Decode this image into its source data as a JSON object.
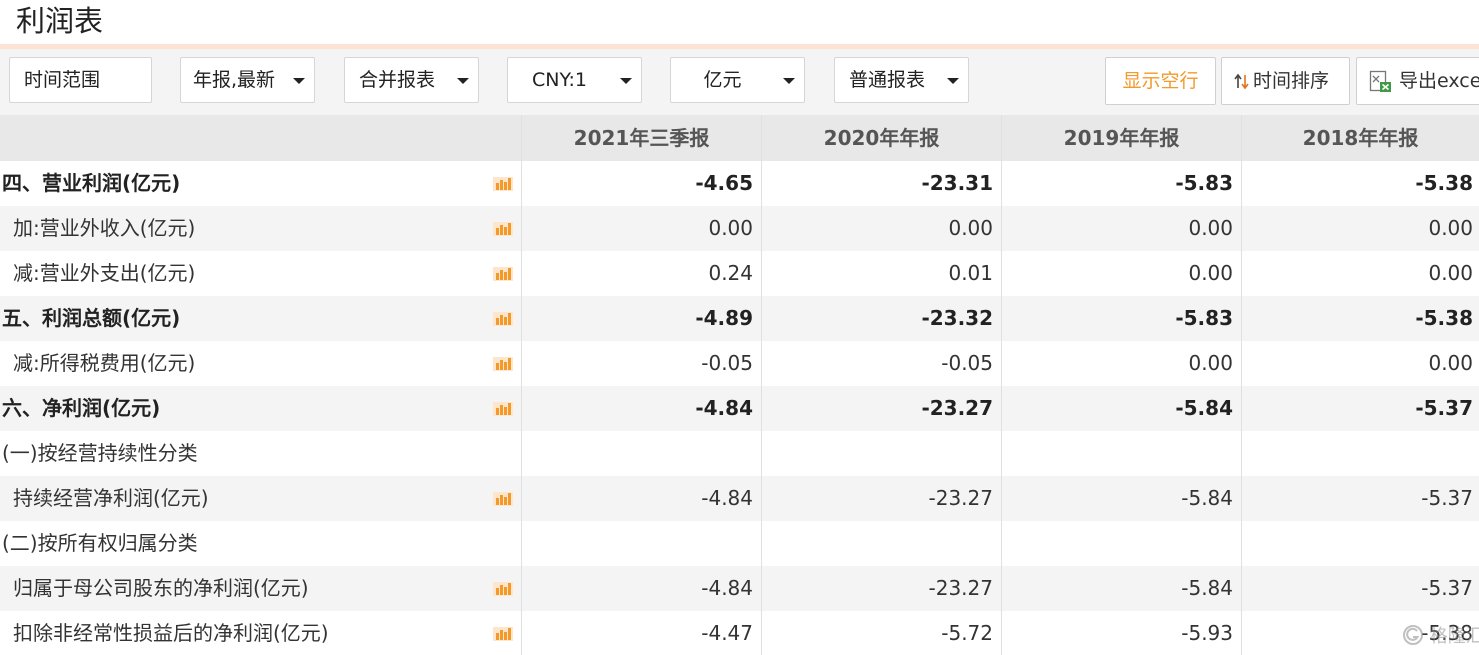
{
  "page": {
    "title": "利润表"
  },
  "toolbar": {
    "time_range": "时间范围",
    "report_period": "年报,最新",
    "report_scope": "合并报表",
    "currency": "CNY:1",
    "unit": "亿元",
    "report_type": "普通报表",
    "show_empty_rows": "显示空行",
    "sort_by_time": "时间排序",
    "export_excel": "导出exce"
  },
  "colors": {
    "accent_orange": "#f39a2a",
    "title_rule": "#fde3d4",
    "chart_icon": "#f39a2a"
  },
  "table": {
    "headers": [
      "",
      "2021年三季报",
      "2020年年报",
      "2019年年报",
      "2018年年报"
    ],
    "rows": [
      {
        "label": "四、营业利润(亿元)",
        "values": [
          "-4.65",
          "-23.31",
          "-5.83",
          "-5.38"
        ],
        "bold": true,
        "icon": "bar-chart-icon"
      },
      {
        "label": "加:营业外收入(亿元)",
        "values": [
          "0.00",
          "0.00",
          "0.00",
          "0.00"
        ],
        "bold": false,
        "icon": "bar-chart-icon"
      },
      {
        "label": "减:营业外支出(亿元)",
        "values": [
          "0.24",
          "0.01",
          "0.00",
          "0.00"
        ],
        "bold": false,
        "icon": "bar-chart-icon"
      },
      {
        "label": "五、利润总额(亿元)",
        "values": [
          "-4.89",
          "-23.32",
          "-5.83",
          "-5.38"
        ],
        "bold": true,
        "icon": "bar-chart-icon"
      },
      {
        "label": "减:所得税费用(亿元)",
        "values": [
          "-0.05",
          "-0.05",
          "0.00",
          "0.00"
        ],
        "bold": false,
        "icon": "bar-chart-icon"
      },
      {
        "label": "六、净利润(亿元)",
        "values": [
          "-4.84",
          "-23.27",
          "-5.84",
          "-5.37"
        ],
        "bold": true,
        "icon": "bar-chart-icon"
      },
      {
        "label": "(一)按经营持续性分类",
        "values": [
          "",
          "",
          "",
          ""
        ],
        "bold": false,
        "icon": ""
      },
      {
        "label": "持续经营净利润(亿元)",
        "values": [
          "-4.84",
          "-23.27",
          "-5.84",
          "-5.37"
        ],
        "bold": false,
        "icon": "bar-chart-icon"
      },
      {
        "label": "(二)按所有权归属分类",
        "values": [
          "",
          "",
          "",
          ""
        ],
        "bold": false,
        "icon": ""
      },
      {
        "label": "归属于母公司股东的净利润(亿元)",
        "values": [
          "-4.84",
          "-23.27",
          "-5.84",
          "-5.37"
        ],
        "bold": false,
        "icon": "bar-chart-icon"
      },
      {
        "label": "扣除非经常性损益后的净利润(亿元)",
        "values": [
          "-4.47",
          "-5.72",
          "-5.93",
          "-5.38"
        ],
        "bold": false,
        "icon": "bar-chart-icon"
      }
    ]
  },
  "watermark": {
    "text": "格隆汇"
  }
}
